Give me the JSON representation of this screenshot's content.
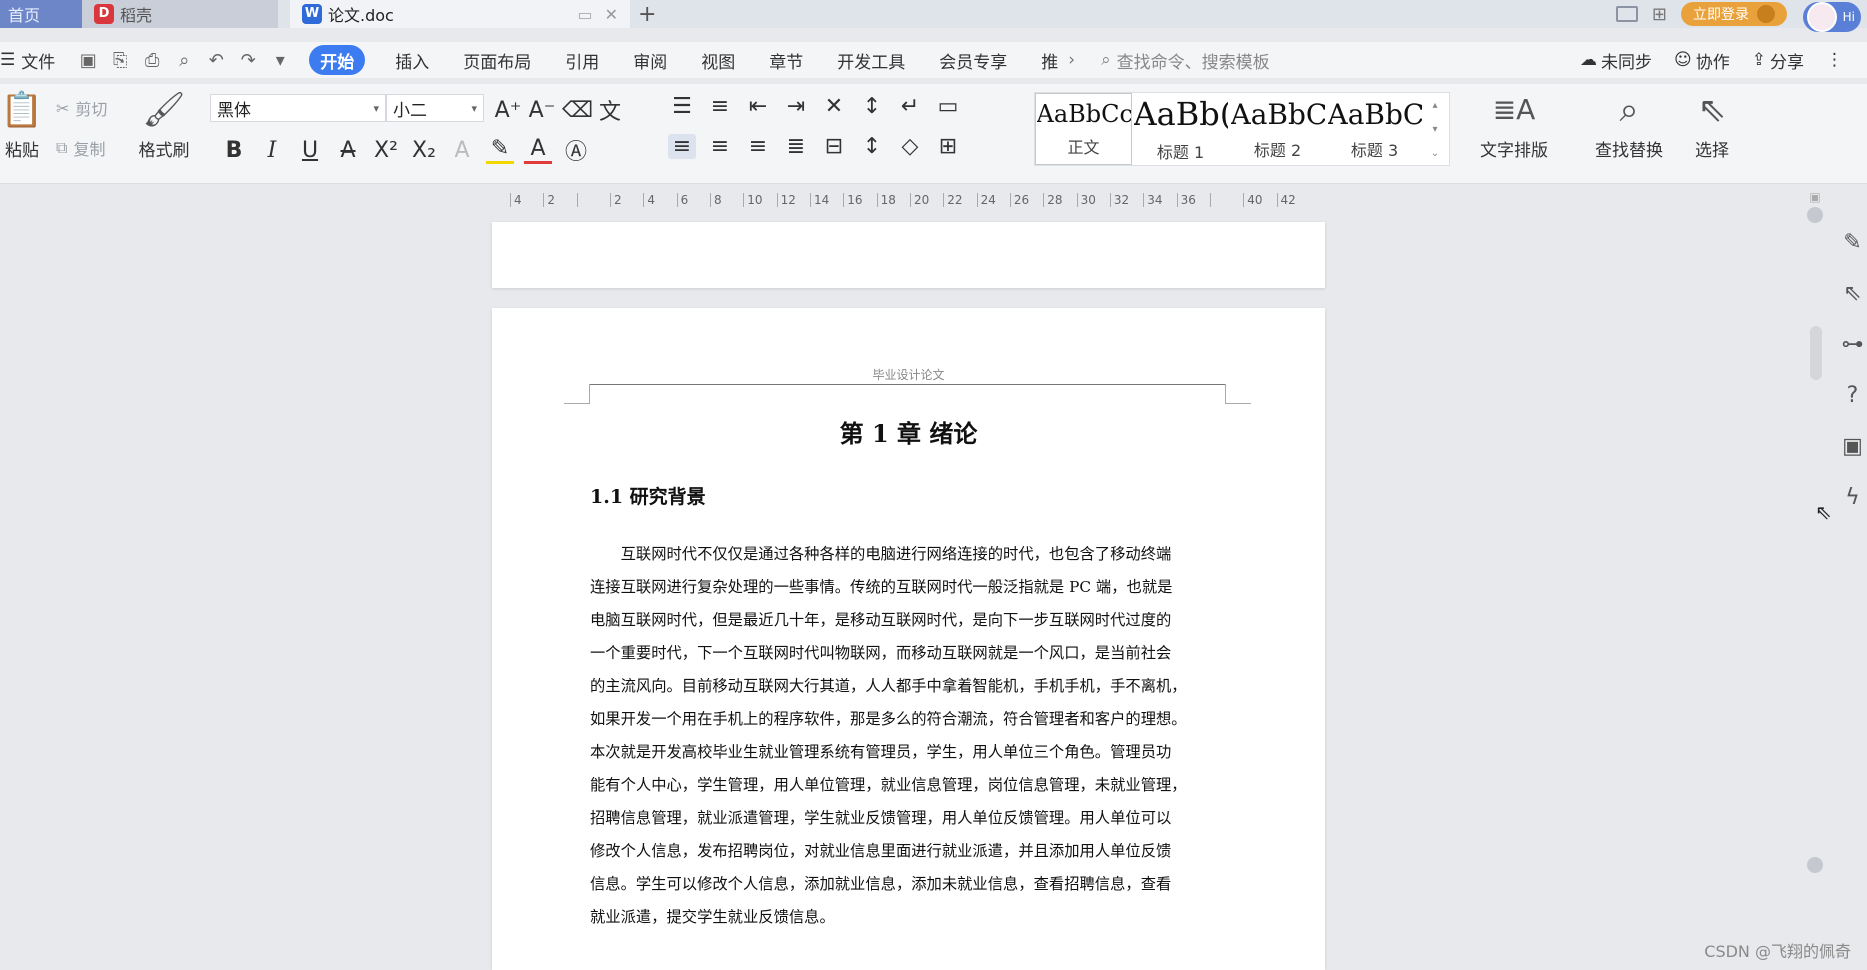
{
  "titlebar": {
    "tabs": [
      {
        "label": "首页"
      },
      {
        "label": "稻壳",
        "icon": "docer-icon"
      },
      {
        "label": "论文.doc",
        "icon": "wps-writer-icon"
      }
    ],
    "login_label": "立即登录",
    "hi_label": "Hi"
  },
  "menu": {
    "file_label": "文件",
    "tabs": [
      "开始",
      "插入",
      "页面布局",
      "引用",
      "审阅",
      "视图",
      "章节",
      "开发工具",
      "会员专享",
      "推"
    ],
    "active_tab": "开始",
    "search_placeholder": "查找命令、搜索模板",
    "sync_label": "未同步",
    "collab_label": "协作",
    "share_label": "分享"
  },
  "ribbon": {
    "paste_label": "粘贴",
    "cut_label": "剪切",
    "copy_label": "复制",
    "format_painter_label": "格式刷",
    "font_name": "黑体",
    "font_size": "小二",
    "styles": [
      {
        "sample": "AaBbCcI",
        "label": "正文"
      },
      {
        "sample": "AaBb(",
        "label": "标题 1"
      },
      {
        "sample": "AaBbC",
        "label": "标题 2"
      },
      {
        "sample": "AaBbCc",
        "label": "标题 3"
      }
    ],
    "text_layout_label": "文字排版",
    "find_replace_label": "查找替换",
    "select_label": "选择"
  },
  "ruler": {
    "ticks": [
      "4",
      "2",
      "",
      "2",
      "4",
      "6",
      "8",
      "10",
      "12",
      "14",
      "16",
      "18",
      "20",
      "22",
      "24",
      "26",
      "28",
      "30",
      "32",
      "34",
      "36",
      "",
      "40",
      "42"
    ]
  },
  "document": {
    "header_text": "毕业设计论文",
    "chapter_title": "第 1 章   绪论",
    "section_title": "1.1   研究背景",
    "paragraph_lines": [
      "　　互联网时代不仅仅是通过各种各样的电脑进行网络连接的时代，也包含了移动终端",
      "连接互联网进行复杂处理的一些事情。传统的互联网时代一般泛指就是 PC 端，也就是",
      "电脑互联网时代，但是最近几十年，是移动互联网时代，是向下一步互联网时代过度的",
      "一个重要时代，下一个互联网时代叫物联网，而移动互联网就是一个风口，是当前社会",
      "的主流风向。目前移动互联网大行其道，人人都手中拿着智能机，手机手机，手不离机，",
      "如果开发一个用在手机上的程序软件，那是多么的符合潮流，符合管理者和客户的理想。",
      "本次就是开发高校毕业生就业管理系统有管理员，学生，用人单位三个角色。管理员功",
      "能有个人中心，学生管理，用人单位管理，就业信息管理，岗位信息管理，未就业管理，",
      "招聘信息管理，就业派遣管理，学生就业反馈管理，用人单位反馈管理。用人单位可以",
      "修改个人信息，发布招聘岗位，对就业信息里面进行就业派遣，并且添加用人单位反馈",
      "信息。学生可以修改个人信息，添加就业信息，添加未就业信息，查看招聘信息，查看",
      "就业派遣，提交学生就业反馈信息。"
    ]
  },
  "watermark": "CSDN @飞翔的佩奇",
  "colors": {
    "accent": "#3c7cf0",
    "home_tab": "#6c86c8",
    "login": "#e9a23b"
  }
}
